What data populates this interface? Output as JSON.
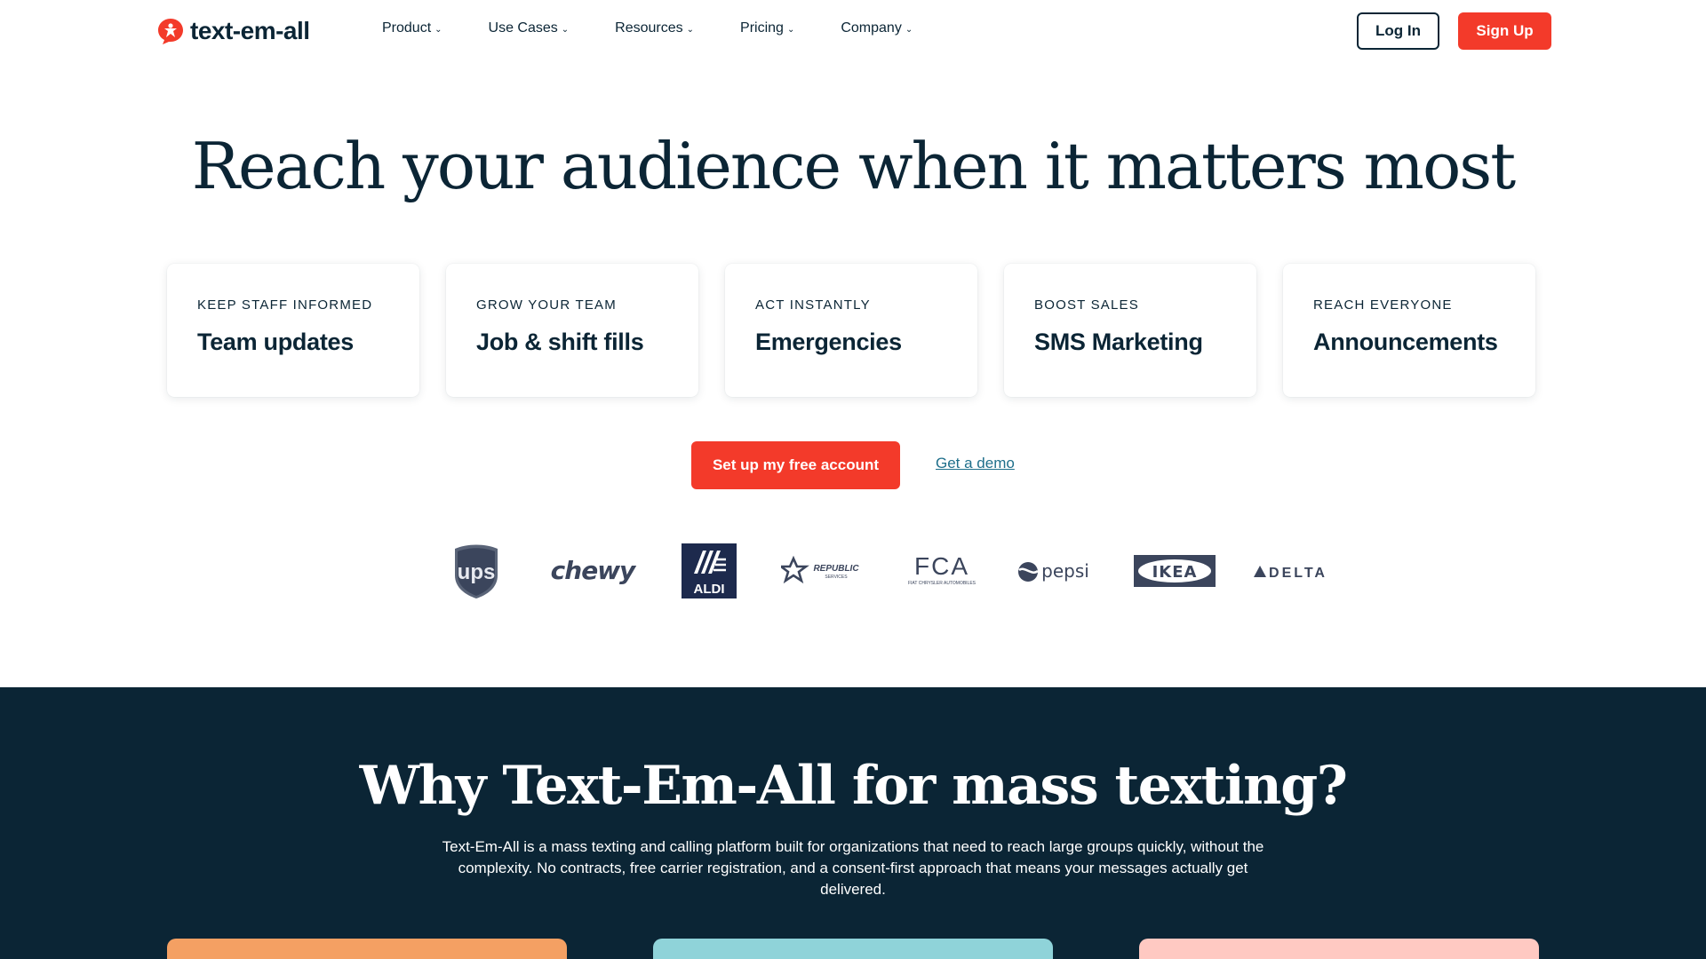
{
  "header": {
    "logo_text": "text-em-all",
    "nav": [
      {
        "label": "Product"
      },
      {
        "label": "Use Cases"
      },
      {
        "label": "Resources"
      },
      {
        "label": "Pricing"
      },
      {
        "label": "Company"
      }
    ],
    "login_label": "Log In",
    "signup_label": "Sign Up"
  },
  "hero": {
    "title": "Reach your audience when it matters most",
    "cards": [
      {
        "kicker": "KEEP STAFF INFORMED",
        "title": "Team updates"
      },
      {
        "kicker": "GROW YOUR TEAM",
        "title": "Job & shift fills"
      },
      {
        "kicker": "ACT INSTANTLY",
        "title": "Emergencies"
      },
      {
        "kicker": "BOOST SALES",
        "title": "SMS Marketing"
      },
      {
        "kicker": "REACH EVERYONE",
        "title": "Announcements"
      }
    ],
    "cta_label": "Set up my free account",
    "demo_label": "Get a demo"
  },
  "logos": {
    "ups": "ups",
    "chewy": "chewy",
    "aldi": "ALDI",
    "republic": "REPUBLIC",
    "republic_sub": "SERVICES",
    "fca": "FCA",
    "fca_sub": "FIAT CHRYSLER AUTOMOBILES",
    "pepsi": "pepsi",
    "ikea": "IKEA",
    "delta": "DELTA"
  },
  "why": {
    "title": "Why Text-Em-All for mass texting?",
    "body": "Text-Em-All is a mass texting and calling platform built for organizations that need to reach large groups quickly, without the complexity. No contracts, free carrier registration, and a consent-first approach that means your messages actually get delivered."
  },
  "colors": {
    "brand_red": "#f33a2a",
    "navy": "#0b2535",
    "link": "#1f6f8b",
    "feature_orange": "#f4a063",
    "feature_teal": "#8fd3d9",
    "feature_pink": "#ffc9c2"
  }
}
